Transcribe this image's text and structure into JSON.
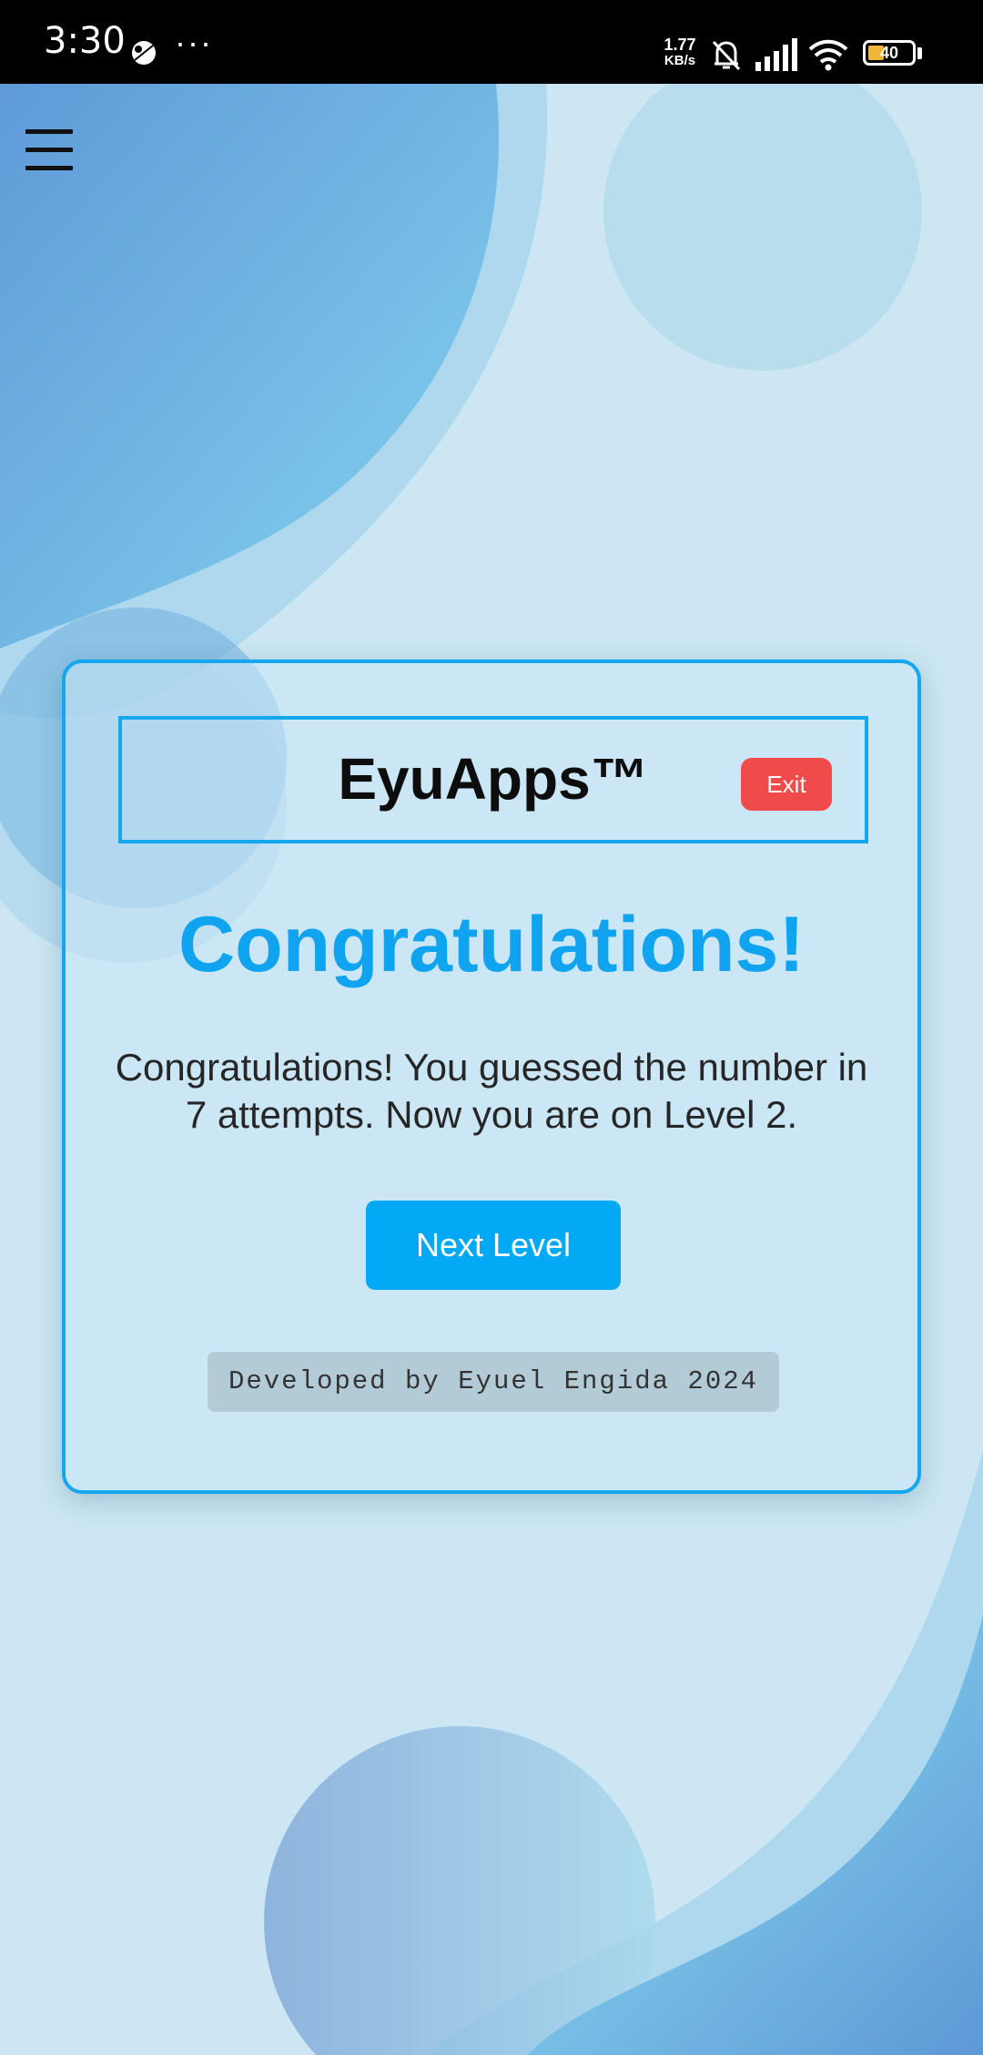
{
  "status_bar": {
    "time": "3:30",
    "more": "···",
    "net_speed_value": "1.77",
    "net_speed_unit": "KB/s",
    "battery_level": "40",
    "icons": [
      "notification-app-icon",
      "silent-bell-icon",
      "signal-icon",
      "wifi-icon",
      "battery-icon"
    ]
  },
  "header": {
    "menu_icon": "hamburger-menu-icon",
    "app_title": "EyuApps™",
    "exit_label": "Exit"
  },
  "main": {
    "heading": "Congratulations!",
    "message": "Congratulations! You guessed the number in 7 attempts. Now you are on Level 2.",
    "next_label": "Next Level",
    "credit": "Developed by Eyuel Engida 2024"
  },
  "colors": {
    "accent": "#03a9f4",
    "exit": "#f04a4a",
    "title": "#10a4f0",
    "background": "#cbe6f2"
  }
}
